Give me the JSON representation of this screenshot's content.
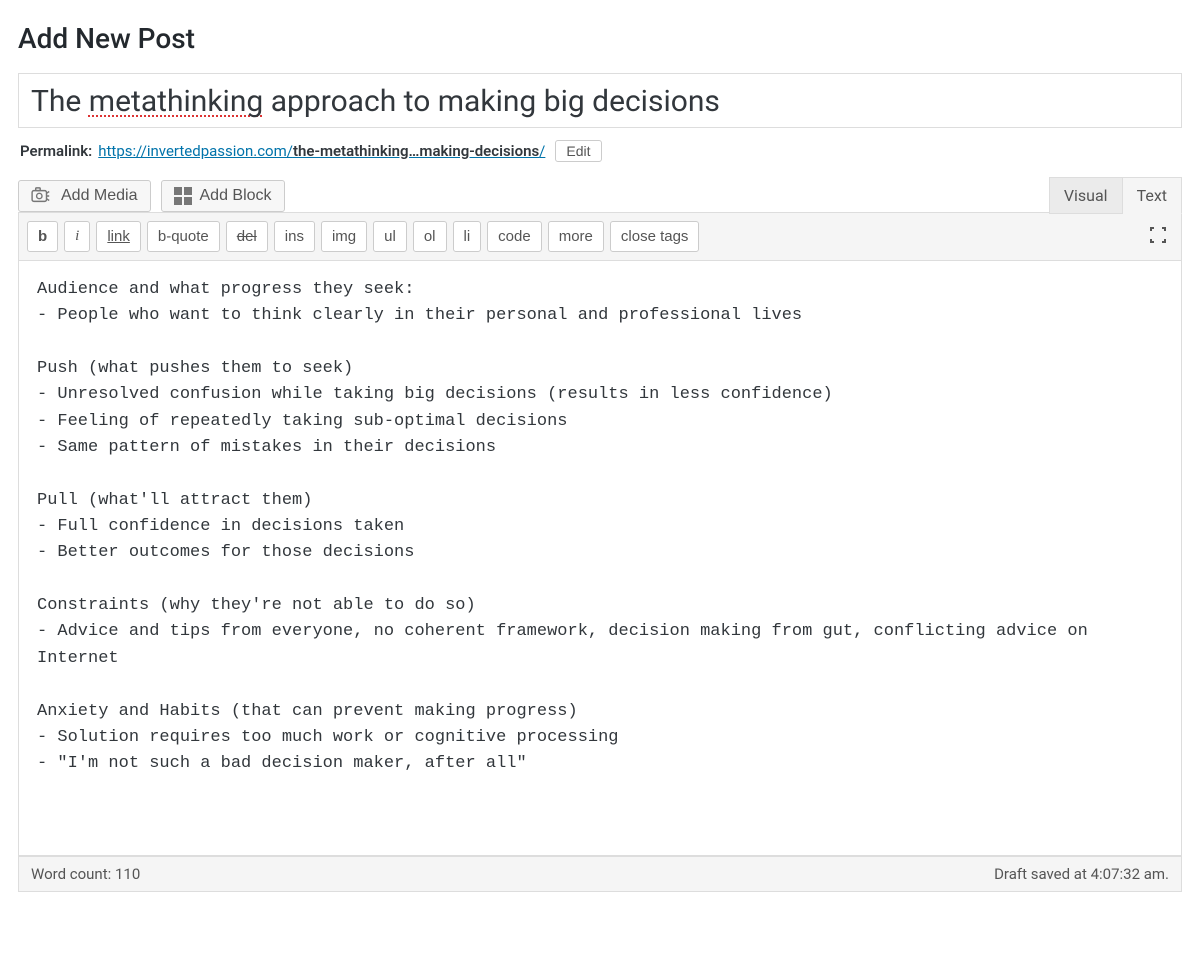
{
  "page": {
    "title": "Add New Post"
  },
  "post": {
    "title_parts": {
      "pre": "The ",
      "spell1": "metathinking",
      "rest": " approach to making big decisions"
    },
    "content": "Audience and what progress they seek:\n- People who want to think clearly in their personal and professional lives\n\nPush (what pushes them to seek)\n- Unresolved confusion while taking big decisions (results in less confidence)\n- Feeling of repeatedly taking sub-optimal decisions\n- Same pattern of mistakes in their decisions\n\nPull (what'll attract them)\n- Full confidence in decisions taken\n- Better outcomes for those decisions\n\nConstraints (why they're not able to do so)\n- Advice and tips from everyone, no coherent framework, decision making from gut, conflicting advice on Internet\n\nAnxiety and Habits (that can prevent making progress)\n- Solution requires too much work or cognitive processing\n- \"I'm not such a bad decision maker, after all\""
  },
  "permalink": {
    "label": "Permalink:",
    "base_url": "https://invertedpassion.com/",
    "slug_display": "the-metathinking…making-decisions",
    "trailing": "/",
    "edit_label": "Edit"
  },
  "media": {
    "add_media": "Add Media",
    "add_block": "Add Block"
  },
  "tabs": {
    "visual": "Visual",
    "text": "Text",
    "active": "text"
  },
  "quicktags": [
    {
      "key": "b",
      "label": "b"
    },
    {
      "key": "i",
      "label": "i"
    },
    {
      "key": "link",
      "label": "link"
    },
    {
      "key": "bquote",
      "label": "b-quote"
    },
    {
      "key": "del",
      "label": "del"
    },
    {
      "key": "ins",
      "label": "ins"
    },
    {
      "key": "img",
      "label": "img"
    },
    {
      "key": "ul",
      "label": "ul"
    },
    {
      "key": "ol",
      "label": "ol"
    },
    {
      "key": "li",
      "label": "li"
    },
    {
      "key": "code",
      "label": "code"
    },
    {
      "key": "more",
      "label": "more"
    },
    {
      "key": "close",
      "label": "close tags"
    }
  ],
  "status": {
    "word_count_label": "Word count: ",
    "word_count_value": "110",
    "draft_saved": "Draft saved at 4:07:32 am."
  }
}
